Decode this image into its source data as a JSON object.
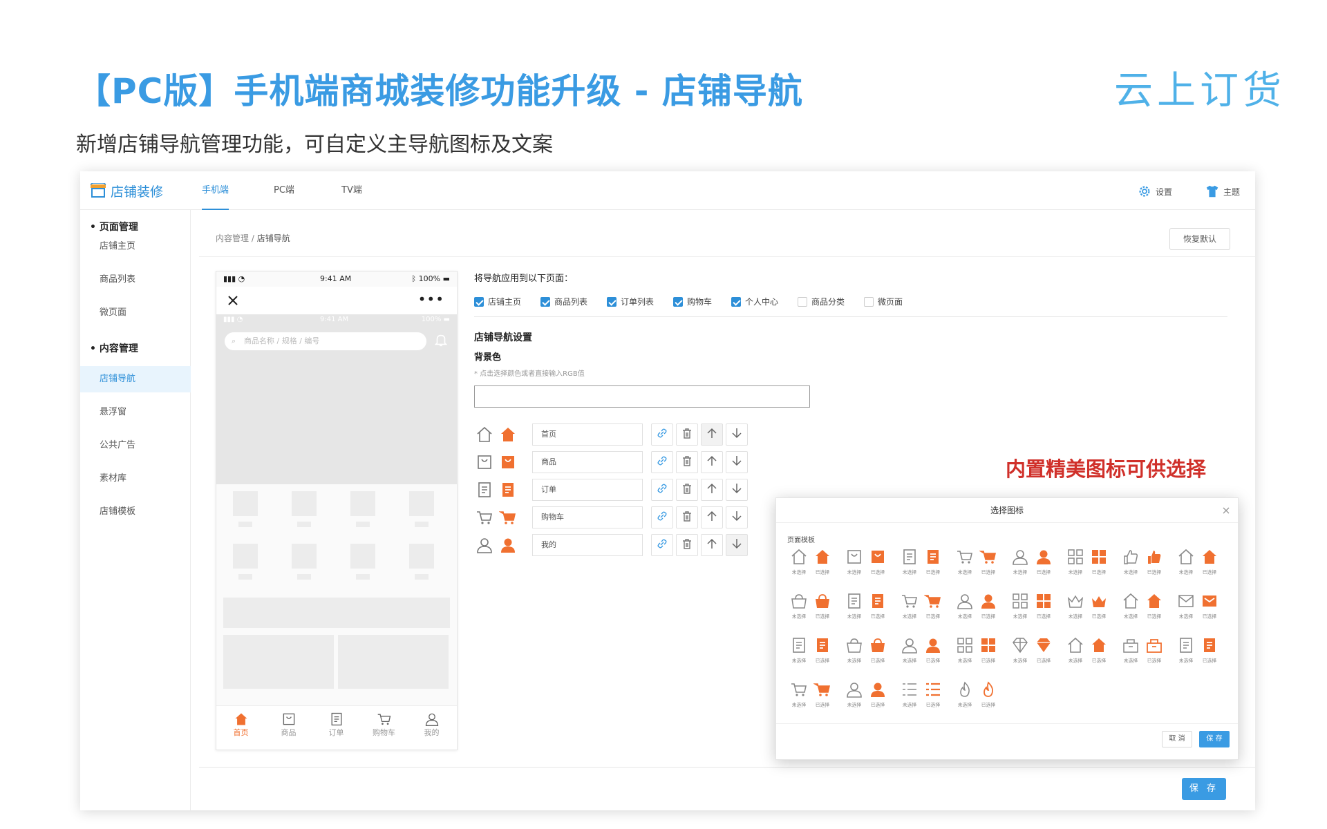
{
  "headline": "【PC版】手机端商城装修功能升级 - 店铺导航",
  "subline": "新增店铺导航管理功能，可自定义主导航图标及文案",
  "logo": "云上订货",
  "promo": "内置精美图标可供选择",
  "colors": {
    "accent": "#3a9be3",
    "orange": "#f07030",
    "promo": "#d0302a",
    "outline": "#888888"
  },
  "topbar": {
    "brand": "店铺装修",
    "tabs": [
      {
        "label": "手机端",
        "active": true
      },
      {
        "label": "PC端"
      },
      {
        "label": "TV端"
      }
    ],
    "settings": "设置",
    "theme": "主题"
  },
  "sidebar": {
    "groups": [
      {
        "label": "页面管理",
        "items": [
          "店铺主页",
          "商品列表",
          "微页面"
        ]
      },
      {
        "label": "内容管理",
        "items": [
          "店铺导航",
          "悬浮窗",
          "公共广告",
          "素材库",
          "店铺模板"
        ]
      }
    ],
    "active_item": "店铺导航"
  },
  "breadcrumb": {
    "root": "内容管理",
    "sep": "/",
    "current": "店铺导航"
  },
  "reset_label": "恢复默认",
  "phone": {
    "time": "9:41 AM",
    "battery": "100%",
    "search_placeholder": "商品名称 / 规格 / 编号",
    "tabs": [
      {
        "label": "首页",
        "icon": "home-icon",
        "active": true
      },
      {
        "label": "商品",
        "icon": "bag-icon"
      },
      {
        "label": "订单",
        "icon": "order-icon"
      },
      {
        "label": "购物车",
        "icon": "cart-icon"
      },
      {
        "label": "我的",
        "icon": "user-icon"
      }
    ]
  },
  "apply": {
    "label": "将导航应用到以下页面：",
    "pages": [
      {
        "label": "店铺主页",
        "checked": true
      },
      {
        "label": "商品列表",
        "checked": true
      },
      {
        "label": "订单列表",
        "checked": true
      },
      {
        "label": "购物车",
        "checked": true
      },
      {
        "label": "个人中心",
        "checked": true
      },
      {
        "label": "商品分类",
        "checked": false
      },
      {
        "label": "微页面",
        "checked": false
      }
    ]
  },
  "settings": {
    "title": "店铺导航设置",
    "bg_label": "背景色",
    "bg_hint": "* 点击选择颜色或者直接输入RGB值",
    "bg_value": ""
  },
  "nav_items": [
    {
      "text": "首页",
      "icon": "home-icon"
    },
    {
      "text": "商品",
      "icon": "bag-icon"
    },
    {
      "text": "订单",
      "icon": "order-icon"
    },
    {
      "text": "购物车",
      "icon": "cart-icon"
    },
    {
      "text": "我的",
      "icon": "user-icon"
    }
  ],
  "modal": {
    "title": "选择图标",
    "section": "页面模板",
    "unselected": "未选择",
    "selected": "已选择",
    "cancel": "取 消",
    "save": "保 存",
    "icon_pairs": [
      "home-icon",
      "bag-icon",
      "order-icon",
      "cart-icon",
      "user-icon",
      "grid-icon",
      "thumb-icon",
      "home-icon",
      "basket-icon",
      "order-icon",
      "cart-icon",
      "user-icon",
      "grid-icon",
      "crown-icon",
      "home-icon",
      "mail-icon",
      "order-icon",
      "basket-icon",
      "user-icon",
      "grid-icon",
      "diamond-icon",
      "home-icon",
      "shop-icon",
      "order-icon",
      "cart-icon",
      "user-icon",
      "list-icon",
      "flame-icon"
    ]
  },
  "save_label": "保 存"
}
